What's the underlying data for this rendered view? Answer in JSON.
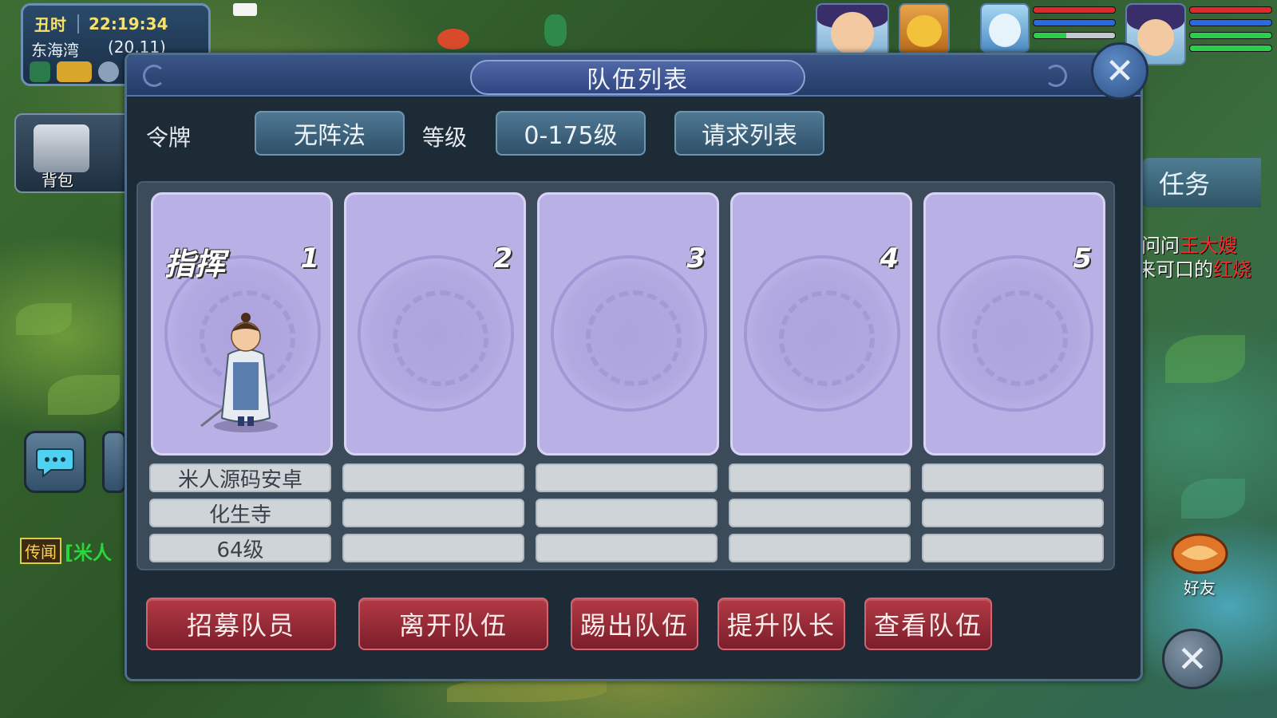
{
  "hud": {
    "period": "丑时",
    "time": "22:19:34",
    "location": "东海湾",
    "coords": "(20,11)",
    "bag_label": "背包",
    "quest_tab": "任务",
    "quest_line1_prefix": "问问",
    "quest_line1_highlight": "王大嫂",
    "quest_line2_prefix": "来可口的",
    "quest_line2_highlight": "红烧",
    "rumor_tag": "传闻",
    "rumor_text": "[米人",
    "friend_label": "好友"
  },
  "dialog": {
    "title": "队伍列表",
    "token_label": "令牌",
    "formation_button": "无阵法",
    "level_label": "等级",
    "level_range_button": "0-175级",
    "request_list_button": "请求列表",
    "slots": [
      {
        "number": "1",
        "role": "指挥",
        "name": "米人源码安卓",
        "school": "化生寺",
        "level": "64级"
      },
      {
        "number": "2",
        "role": "",
        "name": "",
        "school": "",
        "level": ""
      },
      {
        "number": "3",
        "role": "",
        "name": "",
        "school": "",
        "level": ""
      },
      {
        "number": "4",
        "role": "",
        "name": "",
        "school": "",
        "level": ""
      },
      {
        "number": "5",
        "role": "",
        "name": "",
        "school": "",
        "level": ""
      }
    ],
    "buttons": {
      "recruit": "招募队员",
      "leave": "离开队伍",
      "kick": "踢出队伍",
      "promote": "提升队长",
      "view": "查看队伍"
    }
  },
  "colors": {
    "card_bg": "#b9b0e6",
    "red_button": "#b23a45",
    "top_button": "#4f7894",
    "quest_highlight": "#ff2a2a"
  }
}
